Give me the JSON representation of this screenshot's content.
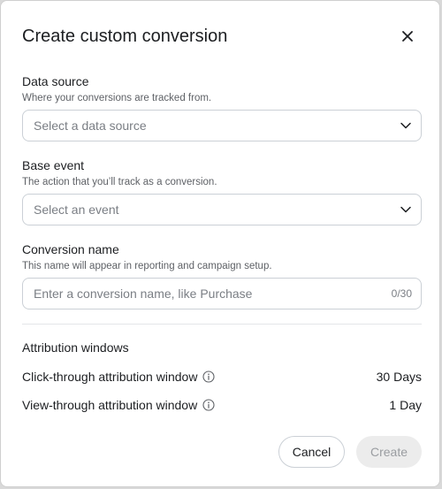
{
  "dialog": {
    "title": "Create custom conversion"
  },
  "data_source": {
    "label": "Data source",
    "help": "Where your conversions are tracked from.",
    "placeholder": "Select a data source"
  },
  "base_event": {
    "label": "Base event",
    "help": "The action that you’ll track as a conversion.",
    "placeholder": "Select an event"
  },
  "conversion_name": {
    "label": "Conversion name",
    "help": "This name will appear in reporting and campaign setup.",
    "placeholder": "Enter a conversion name, like Purchase",
    "value": "",
    "counter": "0/30"
  },
  "attribution": {
    "title": "Attribution windows",
    "click_through": {
      "label": "Click-through attribution window",
      "value": "30 Days"
    },
    "view_through": {
      "label": "View-through attribution window",
      "value": "1 Day"
    }
  },
  "actions": {
    "cancel_label": "Cancel",
    "create_label": "Create"
  },
  "icons": {
    "close": "close-icon",
    "chevron": "chevron-down-icon",
    "info": "info-icon"
  }
}
